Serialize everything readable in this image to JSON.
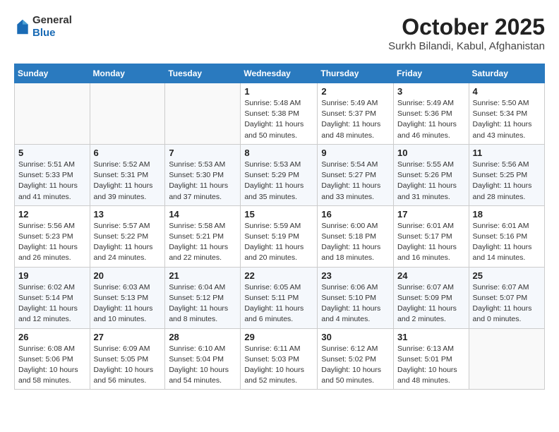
{
  "logo": {
    "general": "General",
    "blue": "Blue"
  },
  "header": {
    "month": "October 2025",
    "location": "Surkh Bilandi, Kabul, Afghanistan"
  },
  "weekdays": [
    "Sunday",
    "Monday",
    "Tuesday",
    "Wednesday",
    "Thursday",
    "Friday",
    "Saturday"
  ],
  "weeks": [
    [
      {
        "day": null,
        "info": null
      },
      {
        "day": null,
        "info": null
      },
      {
        "day": null,
        "info": null
      },
      {
        "day": "1",
        "info": "Sunrise: 5:48 AM\nSunset: 5:38 PM\nDaylight: 11 hours\nand 50 minutes."
      },
      {
        "day": "2",
        "info": "Sunrise: 5:49 AM\nSunset: 5:37 PM\nDaylight: 11 hours\nand 48 minutes."
      },
      {
        "day": "3",
        "info": "Sunrise: 5:49 AM\nSunset: 5:36 PM\nDaylight: 11 hours\nand 46 minutes."
      },
      {
        "day": "4",
        "info": "Sunrise: 5:50 AM\nSunset: 5:34 PM\nDaylight: 11 hours\nand 43 minutes."
      }
    ],
    [
      {
        "day": "5",
        "info": "Sunrise: 5:51 AM\nSunset: 5:33 PM\nDaylight: 11 hours\nand 41 minutes."
      },
      {
        "day": "6",
        "info": "Sunrise: 5:52 AM\nSunset: 5:31 PM\nDaylight: 11 hours\nand 39 minutes."
      },
      {
        "day": "7",
        "info": "Sunrise: 5:53 AM\nSunset: 5:30 PM\nDaylight: 11 hours\nand 37 minutes."
      },
      {
        "day": "8",
        "info": "Sunrise: 5:53 AM\nSunset: 5:29 PM\nDaylight: 11 hours\nand 35 minutes."
      },
      {
        "day": "9",
        "info": "Sunrise: 5:54 AM\nSunset: 5:27 PM\nDaylight: 11 hours\nand 33 minutes."
      },
      {
        "day": "10",
        "info": "Sunrise: 5:55 AM\nSunset: 5:26 PM\nDaylight: 11 hours\nand 31 minutes."
      },
      {
        "day": "11",
        "info": "Sunrise: 5:56 AM\nSunset: 5:25 PM\nDaylight: 11 hours\nand 28 minutes."
      }
    ],
    [
      {
        "day": "12",
        "info": "Sunrise: 5:56 AM\nSunset: 5:23 PM\nDaylight: 11 hours\nand 26 minutes."
      },
      {
        "day": "13",
        "info": "Sunrise: 5:57 AM\nSunset: 5:22 PM\nDaylight: 11 hours\nand 24 minutes."
      },
      {
        "day": "14",
        "info": "Sunrise: 5:58 AM\nSunset: 5:21 PM\nDaylight: 11 hours\nand 22 minutes."
      },
      {
        "day": "15",
        "info": "Sunrise: 5:59 AM\nSunset: 5:19 PM\nDaylight: 11 hours\nand 20 minutes."
      },
      {
        "day": "16",
        "info": "Sunrise: 6:00 AM\nSunset: 5:18 PM\nDaylight: 11 hours\nand 18 minutes."
      },
      {
        "day": "17",
        "info": "Sunrise: 6:01 AM\nSunset: 5:17 PM\nDaylight: 11 hours\nand 16 minutes."
      },
      {
        "day": "18",
        "info": "Sunrise: 6:01 AM\nSunset: 5:16 PM\nDaylight: 11 hours\nand 14 minutes."
      }
    ],
    [
      {
        "day": "19",
        "info": "Sunrise: 6:02 AM\nSunset: 5:14 PM\nDaylight: 11 hours\nand 12 minutes."
      },
      {
        "day": "20",
        "info": "Sunrise: 6:03 AM\nSunset: 5:13 PM\nDaylight: 11 hours\nand 10 minutes."
      },
      {
        "day": "21",
        "info": "Sunrise: 6:04 AM\nSunset: 5:12 PM\nDaylight: 11 hours\nand 8 minutes."
      },
      {
        "day": "22",
        "info": "Sunrise: 6:05 AM\nSunset: 5:11 PM\nDaylight: 11 hours\nand 6 minutes."
      },
      {
        "day": "23",
        "info": "Sunrise: 6:06 AM\nSunset: 5:10 PM\nDaylight: 11 hours\nand 4 minutes."
      },
      {
        "day": "24",
        "info": "Sunrise: 6:07 AM\nSunset: 5:09 PM\nDaylight: 11 hours\nand 2 minutes."
      },
      {
        "day": "25",
        "info": "Sunrise: 6:07 AM\nSunset: 5:07 PM\nDaylight: 11 hours\nand 0 minutes."
      }
    ],
    [
      {
        "day": "26",
        "info": "Sunrise: 6:08 AM\nSunset: 5:06 PM\nDaylight: 10 hours\nand 58 minutes."
      },
      {
        "day": "27",
        "info": "Sunrise: 6:09 AM\nSunset: 5:05 PM\nDaylight: 10 hours\nand 56 minutes."
      },
      {
        "day": "28",
        "info": "Sunrise: 6:10 AM\nSunset: 5:04 PM\nDaylight: 10 hours\nand 54 minutes."
      },
      {
        "day": "29",
        "info": "Sunrise: 6:11 AM\nSunset: 5:03 PM\nDaylight: 10 hours\nand 52 minutes."
      },
      {
        "day": "30",
        "info": "Sunrise: 6:12 AM\nSunset: 5:02 PM\nDaylight: 10 hours\nand 50 minutes."
      },
      {
        "day": "31",
        "info": "Sunrise: 6:13 AM\nSunset: 5:01 PM\nDaylight: 10 hours\nand 48 minutes."
      },
      {
        "day": null,
        "info": null
      }
    ]
  ]
}
